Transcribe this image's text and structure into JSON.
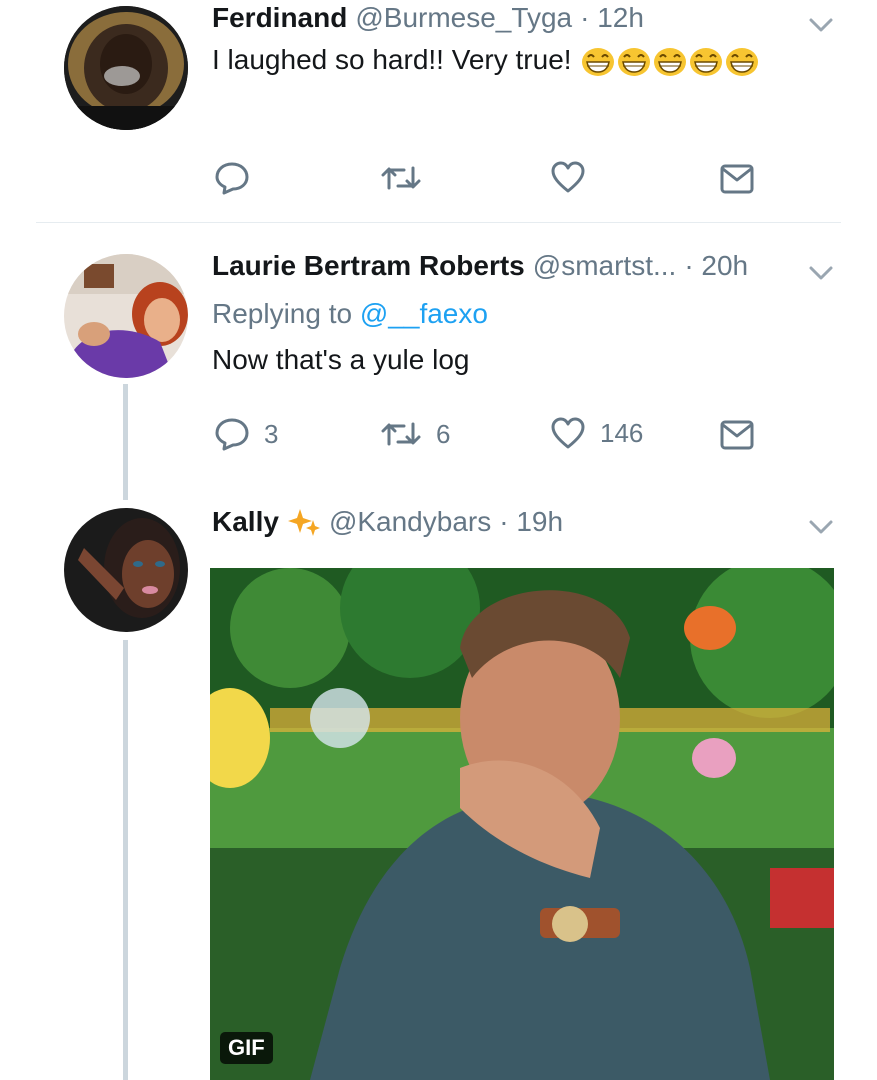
{
  "tweets": [
    {
      "name": "Ferdinand",
      "handle": "@Burmese_Tyga",
      "time": "· 12h",
      "text": "I laughed so hard!! Very true!",
      "emoji_count": 5,
      "reply_count": "",
      "retweet_count": "",
      "like_count": ""
    },
    {
      "name": "Laurie Bertram Roberts",
      "handle": "@smartst...",
      "time": "· 20h",
      "replying_prefix": "Replying to",
      "replying_to": "@__faexo",
      "text": "Now that's a yule log",
      "reply_count": "3",
      "retweet_count": "6",
      "like_count": "146"
    },
    {
      "name": "Kally",
      "handle": "@Kandybars",
      "time": "· 19h",
      "media_badge": "GIF"
    }
  ],
  "colors": {
    "accent": "#1da1f2",
    "muted": "#657786",
    "thread_line": "#ccd6dd",
    "sparkle": "#f5a623"
  },
  "icons": [
    "reply-icon",
    "retweet-icon",
    "like-icon",
    "dm-icon",
    "chevron-down-icon",
    "sparkle-icon",
    "laughing-emoji-icon"
  ]
}
